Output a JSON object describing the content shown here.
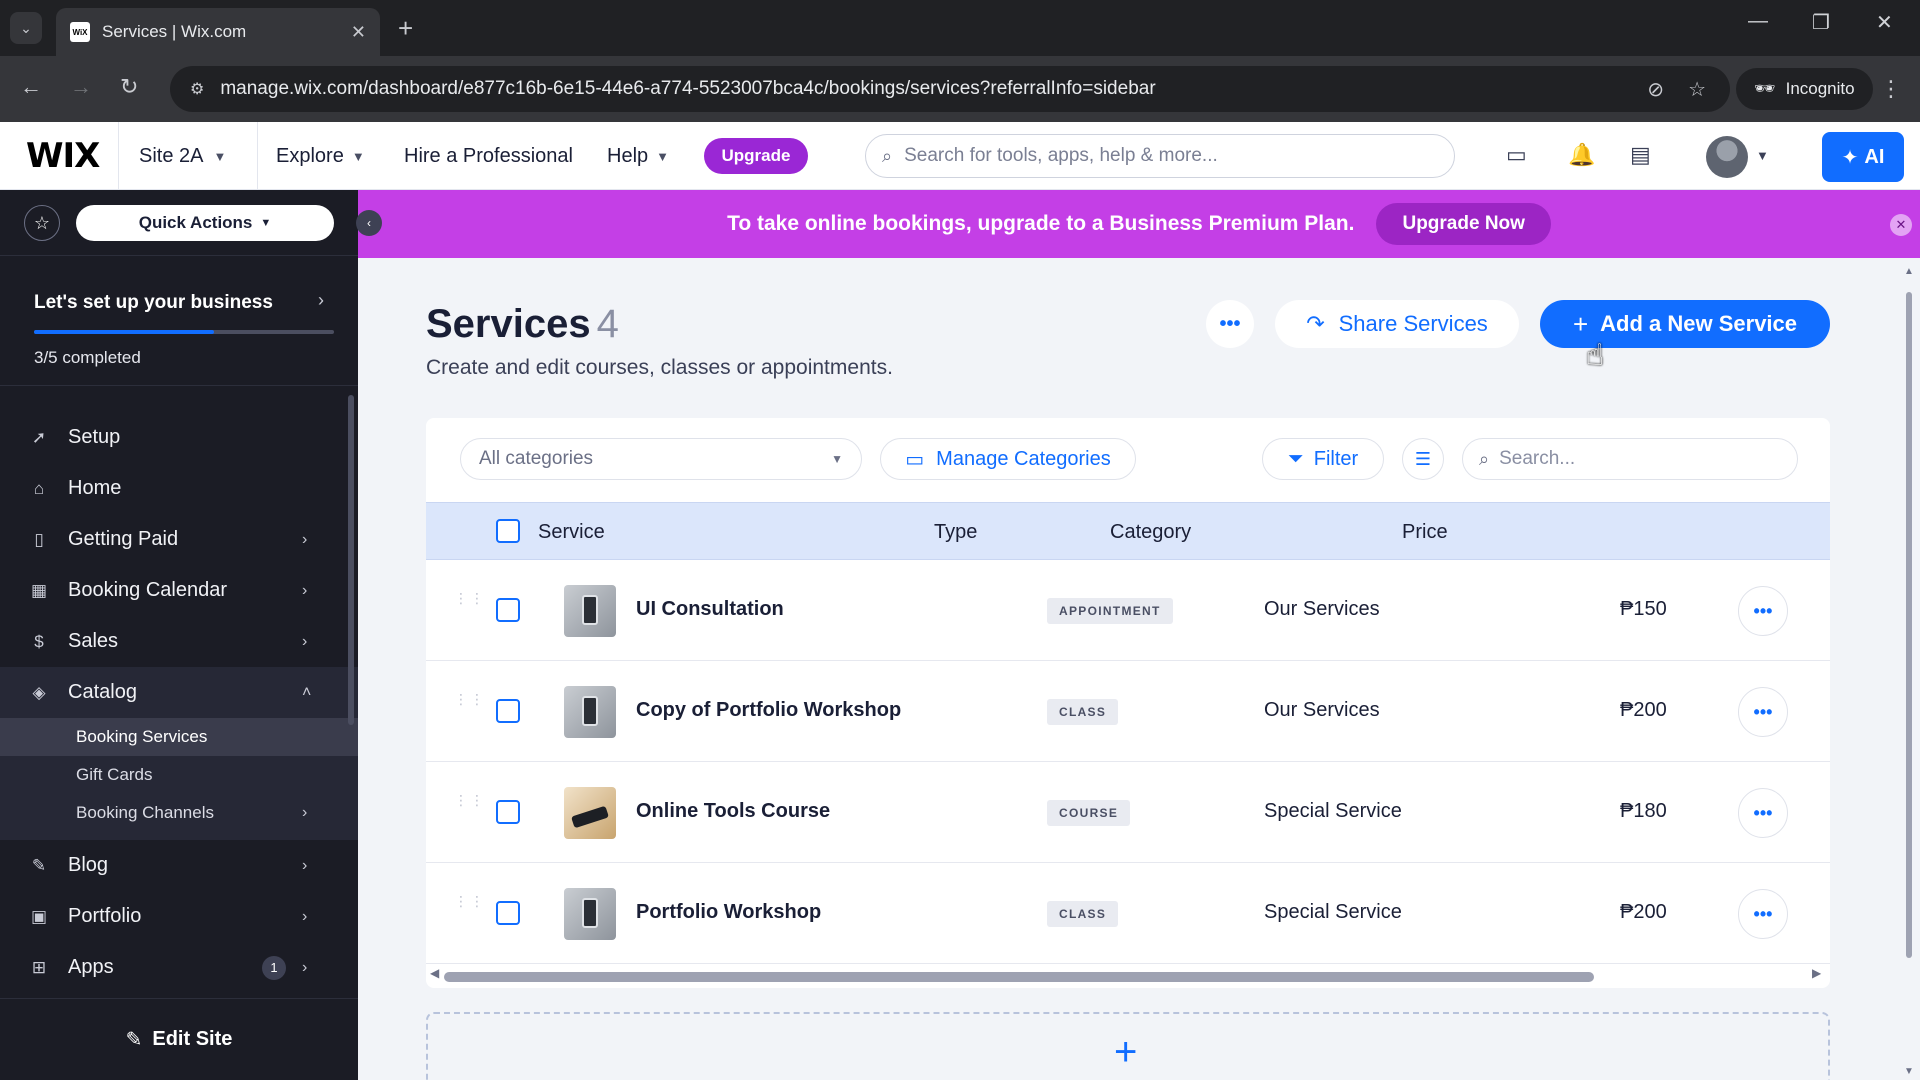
{
  "browser": {
    "tab_title": "Services | Wix.com",
    "favicon_text": "WiX",
    "url": "manage.wix.com/dashboard/e877c16b-6e15-44e6-a774-5523007bca4c/bookings/services?referralInfo=sidebar",
    "incognito_label": "Incognito"
  },
  "topbar": {
    "logo": "WIX",
    "site_name": "Site 2A",
    "explore": "Explore",
    "hire": "Hire a Professional",
    "help": "Help",
    "upgrade": "Upgrade",
    "search_placeholder": "Search for tools, apps, help & more...",
    "ai_label": "AI"
  },
  "sidebar": {
    "quick_actions": "Quick Actions",
    "setup_title": "Let's set up your business",
    "setup_progress": 0.6,
    "setup_count": "3/5 completed",
    "items": [
      {
        "label": "Setup",
        "icon": "rocket-icon"
      },
      {
        "label": "Home",
        "icon": "home-icon"
      },
      {
        "label": "Getting Paid",
        "icon": "receipt-icon"
      },
      {
        "label": "Booking Calendar",
        "icon": "calendar-icon"
      },
      {
        "label": "Sales",
        "icon": "dollar-icon"
      },
      {
        "label": "Catalog",
        "icon": "catalog-icon"
      },
      {
        "label": "Blog",
        "icon": "blog-icon"
      },
      {
        "label": "Portfolio",
        "icon": "portfolio-icon"
      },
      {
        "label": "Apps",
        "icon": "apps-icon",
        "badge": "1"
      }
    ],
    "catalog_sub": [
      "Booking Services",
      "Gift Cards",
      "Booking Channels"
    ],
    "edit_site": "Edit Site"
  },
  "banner": {
    "text": "To take online bookings, upgrade to a Business Premium Plan.",
    "button": "Upgrade Now"
  },
  "page": {
    "title": "Services",
    "count": "4",
    "subtitle": "Create and edit courses, classes or appointments.",
    "share": "Share Services",
    "add": "Add a New Service"
  },
  "toolbar": {
    "category_select": "All categories",
    "manage_categories": "Manage Categories",
    "filter": "Filter",
    "search_placeholder": "Search..."
  },
  "table": {
    "headers": {
      "service": "Service",
      "type": "Type",
      "category": "Category",
      "price": "Price"
    },
    "rows": [
      {
        "name": "UI Consultation",
        "type": "APPOINTMENT",
        "category": "Our Services",
        "price": "₱150",
        "thumb": "phone"
      },
      {
        "name": "Copy of Portfolio Workshop",
        "type": "CLASS",
        "category": "Our Services",
        "price": "₱200",
        "thumb": "phone"
      },
      {
        "name": "Online Tools Course",
        "type": "COURSE",
        "category": "Special Service",
        "price": "₱180",
        "thumb": "course"
      },
      {
        "name": "Portfolio Workshop",
        "type": "CLASS",
        "category": "Special Service",
        "price": "₱200",
        "thumb": "phone"
      }
    ]
  },
  "colors": {
    "accent": "#116dff",
    "banner": "#c43fe6",
    "sidebar": "#1b1c25",
    "upgrade": "#9a27d5"
  }
}
